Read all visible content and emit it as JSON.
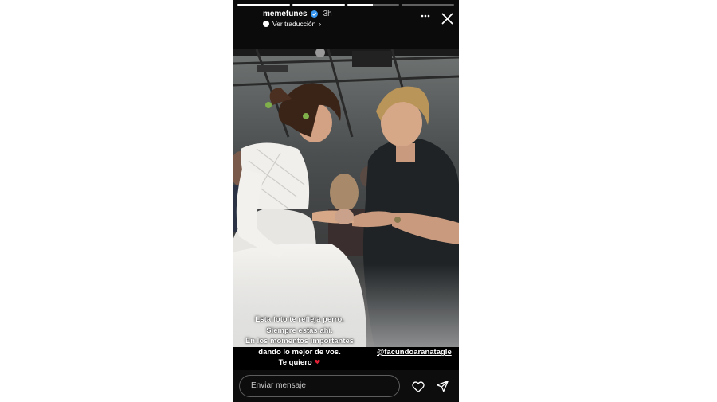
{
  "story": {
    "progress": [
      1,
      1,
      0.5,
      0
    ],
    "user": {
      "username": "memefunes",
      "time": "3h",
      "translate_label": "Ver traducción",
      "translate_chevron": "›"
    },
    "caption_lines": [
      "Esta foto te refleja perro.",
      "Siempre estás ahí.",
      "En los momentos importantes",
      "dando lo mejor de vos.",
      "Te quiero"
    ],
    "caption_emoji": "❤",
    "mention": "@facundoaranatagle",
    "reply": {
      "placeholder": "Enviar mensaje"
    }
  },
  "colors": {
    "verified": "#3897f0",
    "heart": "#e22136"
  },
  "icons": [
    "verified-badge-icon",
    "translate-icon",
    "more-options-icon",
    "close-icon",
    "like-heart-icon",
    "send-icon"
  ]
}
